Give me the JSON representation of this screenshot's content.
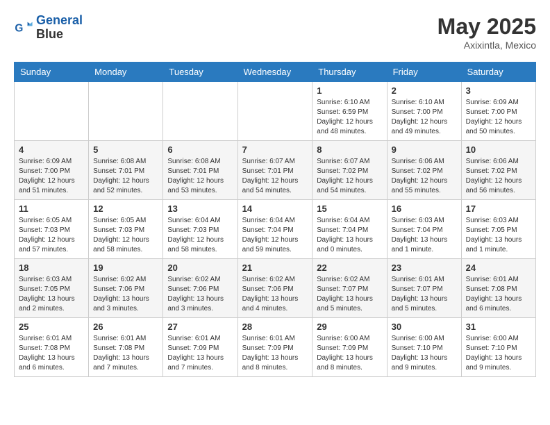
{
  "header": {
    "logo_line1": "General",
    "logo_line2": "Blue",
    "month_year": "May 2025",
    "location": "Axixintla, Mexico"
  },
  "weekdays": [
    "Sunday",
    "Monday",
    "Tuesday",
    "Wednesday",
    "Thursday",
    "Friday",
    "Saturday"
  ],
  "weeks": [
    [
      {
        "day": "",
        "info": ""
      },
      {
        "day": "",
        "info": ""
      },
      {
        "day": "",
        "info": ""
      },
      {
        "day": "",
        "info": ""
      },
      {
        "day": "1",
        "info": "Sunrise: 6:10 AM\nSunset: 6:59 PM\nDaylight: 12 hours\nand 48 minutes."
      },
      {
        "day": "2",
        "info": "Sunrise: 6:10 AM\nSunset: 7:00 PM\nDaylight: 12 hours\nand 49 minutes."
      },
      {
        "day": "3",
        "info": "Sunrise: 6:09 AM\nSunset: 7:00 PM\nDaylight: 12 hours\nand 50 minutes."
      }
    ],
    [
      {
        "day": "4",
        "info": "Sunrise: 6:09 AM\nSunset: 7:00 PM\nDaylight: 12 hours\nand 51 minutes."
      },
      {
        "day": "5",
        "info": "Sunrise: 6:08 AM\nSunset: 7:01 PM\nDaylight: 12 hours\nand 52 minutes."
      },
      {
        "day": "6",
        "info": "Sunrise: 6:08 AM\nSunset: 7:01 PM\nDaylight: 12 hours\nand 53 minutes."
      },
      {
        "day": "7",
        "info": "Sunrise: 6:07 AM\nSunset: 7:01 PM\nDaylight: 12 hours\nand 54 minutes."
      },
      {
        "day": "8",
        "info": "Sunrise: 6:07 AM\nSunset: 7:02 PM\nDaylight: 12 hours\nand 54 minutes."
      },
      {
        "day": "9",
        "info": "Sunrise: 6:06 AM\nSunset: 7:02 PM\nDaylight: 12 hours\nand 55 minutes."
      },
      {
        "day": "10",
        "info": "Sunrise: 6:06 AM\nSunset: 7:02 PM\nDaylight: 12 hours\nand 56 minutes."
      }
    ],
    [
      {
        "day": "11",
        "info": "Sunrise: 6:05 AM\nSunset: 7:03 PM\nDaylight: 12 hours\nand 57 minutes."
      },
      {
        "day": "12",
        "info": "Sunrise: 6:05 AM\nSunset: 7:03 PM\nDaylight: 12 hours\nand 58 minutes."
      },
      {
        "day": "13",
        "info": "Sunrise: 6:04 AM\nSunset: 7:03 PM\nDaylight: 12 hours\nand 58 minutes."
      },
      {
        "day": "14",
        "info": "Sunrise: 6:04 AM\nSunset: 7:04 PM\nDaylight: 12 hours\nand 59 minutes."
      },
      {
        "day": "15",
        "info": "Sunrise: 6:04 AM\nSunset: 7:04 PM\nDaylight: 13 hours\nand 0 minutes."
      },
      {
        "day": "16",
        "info": "Sunrise: 6:03 AM\nSunset: 7:04 PM\nDaylight: 13 hours\nand 1 minute."
      },
      {
        "day": "17",
        "info": "Sunrise: 6:03 AM\nSunset: 7:05 PM\nDaylight: 13 hours\nand 1 minute."
      }
    ],
    [
      {
        "day": "18",
        "info": "Sunrise: 6:03 AM\nSunset: 7:05 PM\nDaylight: 13 hours\nand 2 minutes."
      },
      {
        "day": "19",
        "info": "Sunrise: 6:02 AM\nSunset: 7:06 PM\nDaylight: 13 hours\nand 3 minutes."
      },
      {
        "day": "20",
        "info": "Sunrise: 6:02 AM\nSunset: 7:06 PM\nDaylight: 13 hours\nand 3 minutes."
      },
      {
        "day": "21",
        "info": "Sunrise: 6:02 AM\nSunset: 7:06 PM\nDaylight: 13 hours\nand 4 minutes."
      },
      {
        "day": "22",
        "info": "Sunrise: 6:02 AM\nSunset: 7:07 PM\nDaylight: 13 hours\nand 5 minutes."
      },
      {
        "day": "23",
        "info": "Sunrise: 6:01 AM\nSunset: 7:07 PM\nDaylight: 13 hours\nand 5 minutes."
      },
      {
        "day": "24",
        "info": "Sunrise: 6:01 AM\nSunset: 7:08 PM\nDaylight: 13 hours\nand 6 minutes."
      }
    ],
    [
      {
        "day": "25",
        "info": "Sunrise: 6:01 AM\nSunset: 7:08 PM\nDaylight: 13 hours\nand 6 minutes."
      },
      {
        "day": "26",
        "info": "Sunrise: 6:01 AM\nSunset: 7:08 PM\nDaylight: 13 hours\nand 7 minutes."
      },
      {
        "day": "27",
        "info": "Sunrise: 6:01 AM\nSunset: 7:09 PM\nDaylight: 13 hours\nand 7 minutes."
      },
      {
        "day": "28",
        "info": "Sunrise: 6:01 AM\nSunset: 7:09 PM\nDaylight: 13 hours\nand 8 minutes."
      },
      {
        "day": "29",
        "info": "Sunrise: 6:00 AM\nSunset: 7:09 PM\nDaylight: 13 hours\nand 8 minutes."
      },
      {
        "day": "30",
        "info": "Sunrise: 6:00 AM\nSunset: 7:10 PM\nDaylight: 13 hours\nand 9 minutes."
      },
      {
        "day": "31",
        "info": "Sunrise: 6:00 AM\nSunset: 7:10 PM\nDaylight: 13 hours\nand 9 minutes."
      }
    ]
  ]
}
